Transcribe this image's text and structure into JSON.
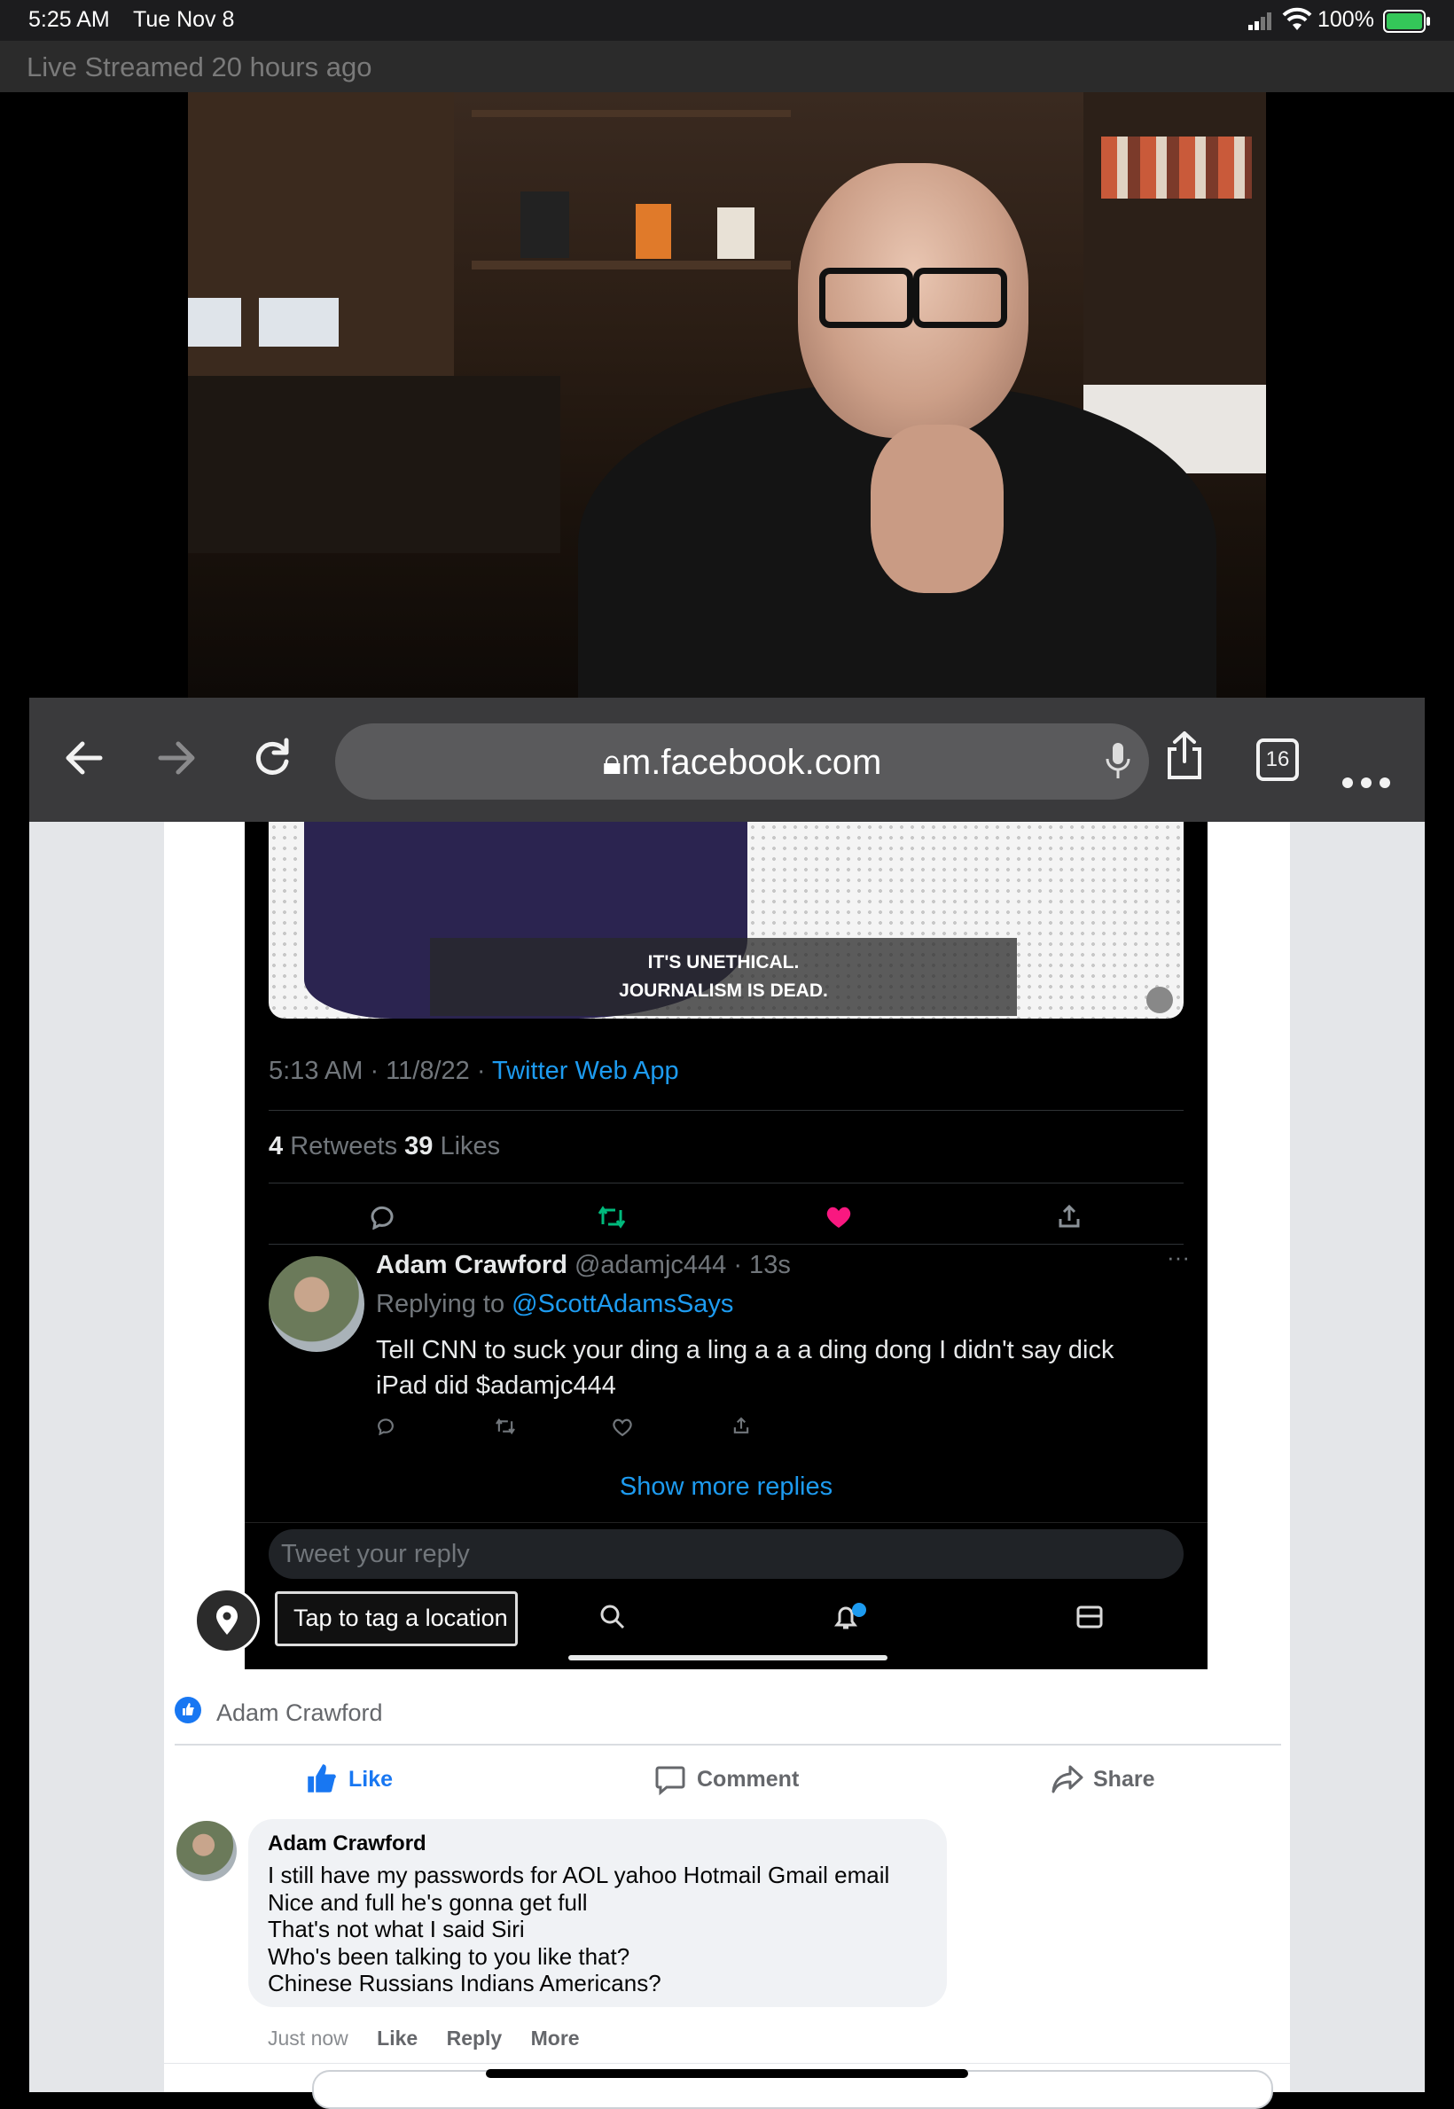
{
  "status_bar": {
    "time": "5:25 AM",
    "date": "Tue Nov 8",
    "battery": "100%"
  },
  "live_banner": {
    "text": "Live Streamed 20 hours ago"
  },
  "browser": {
    "url": "m.facebook.com",
    "tab_count": "16"
  },
  "tweet": {
    "caption_line1": "IT'S UNETHICAL.",
    "caption_line2": "JOURNALISM IS DEAD.",
    "timestamp": "5:13 AM · 11/8/22 · ",
    "source": "Twitter Web App",
    "retweets_count": "4",
    "retweets_label": " Retweets ",
    "likes_count": "39",
    "likes_label": " Likes",
    "reply": {
      "name": "Adam Crawford",
      "handle_time": " @adamjc444 · 13s",
      "replying_to_label": "Replying to ",
      "replying_to": "@ScottAdamsSays",
      "text_line1": "Tell CNN to suck your ding a ling a a a ding dong I didn't say dick",
      "text_line2": "iPad did $adamjc444"
    },
    "show_more_replies": "Show more replies",
    "reply_placeholder": "Tweet your reply",
    "location_tooltip": "Tap to tag a location"
  },
  "facebook": {
    "reaction_name": "Adam Crawford",
    "like_label": "Like",
    "comment_label": "Comment",
    "share_label": "Share",
    "comment": {
      "author": "Adam Crawford",
      "lines": [
        "I still have my passwords for AOL yahoo Hotmail Gmail email",
        "Nice and full he's gonna get full",
        "That's not what I said Siri",
        "Who's been talking to you like that?",
        "Chinese Russians Indians Americans?"
      ],
      "time": "Just now",
      "like": "Like",
      "reply": "Reply",
      "more": "More"
    }
  },
  "colors": {
    "twitter_blue": "#1d9bf0",
    "facebook_blue": "#1877f2",
    "like_pink": "#f91880",
    "retweet_green": "#00ba7c"
  }
}
